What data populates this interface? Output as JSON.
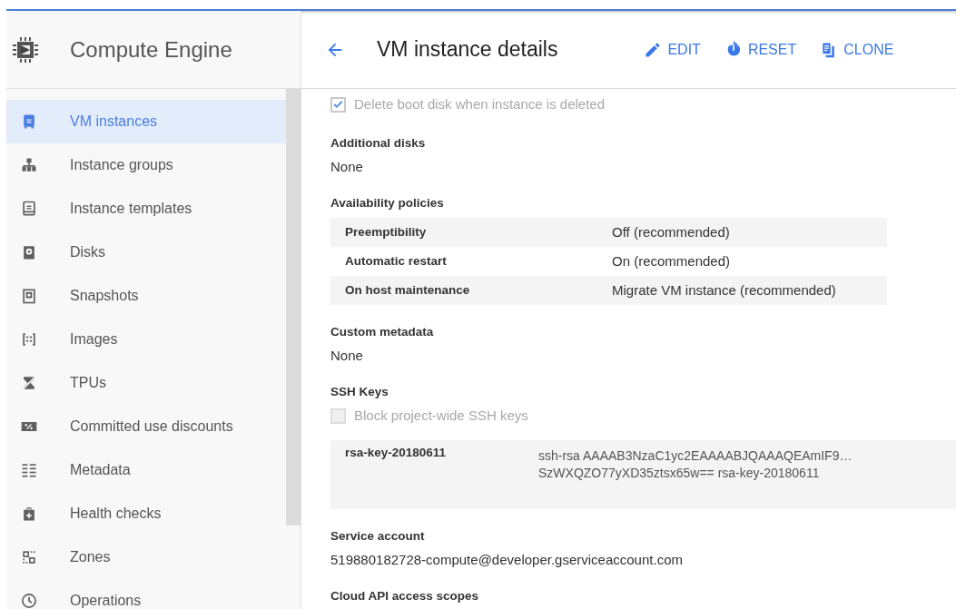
{
  "sidebar": {
    "product": "Compute Engine",
    "items": [
      {
        "label": "VM instances",
        "selected": true
      },
      {
        "label": "Instance groups",
        "selected": false
      },
      {
        "label": "Instance templates",
        "selected": false
      },
      {
        "label": "Disks",
        "selected": false
      },
      {
        "label": "Snapshots",
        "selected": false
      },
      {
        "label": "Images",
        "selected": false
      },
      {
        "label": "TPUs",
        "selected": false
      },
      {
        "label": "Committed use discounts",
        "selected": false
      },
      {
        "label": "Metadata",
        "selected": false
      },
      {
        "label": "Health checks",
        "selected": false
      },
      {
        "label": "Zones",
        "selected": false
      },
      {
        "label": "Operations",
        "selected": false
      }
    ]
  },
  "page": {
    "title": "VM instance details",
    "actions": [
      {
        "label": "EDIT"
      },
      {
        "label": "RESET"
      },
      {
        "label": "CLONE"
      }
    ]
  },
  "content": [
    {
      "kind": "checkbox",
      "label": "Delete boot disk when instance is deleted",
      "checked": true
    },
    {
      "kind": "heading",
      "text": "Additional disks"
    },
    {
      "kind": "value",
      "text": "None"
    },
    {
      "kind": "heading",
      "text": "Availability policies"
    },
    {
      "kind": "table",
      "rows": [
        {
          "label": "Preemptibility",
          "value": "Off (recommended)"
        },
        {
          "label": "Automatic restart",
          "value": "On (recommended)"
        },
        {
          "label": "On host maintenance",
          "value": "Migrate VM instance (recommended)"
        }
      ]
    },
    {
      "kind": "heading",
      "text": "Custom metadata"
    },
    {
      "kind": "value",
      "text": "None"
    },
    {
      "kind": "heading",
      "text": "SSH Keys"
    },
    {
      "kind": "checkbox",
      "label": "Block project-wide SSH keys",
      "checked": false
    },
    {
      "kind": "keys",
      "rows": [
        {
          "name": "rsa-key-20180611",
          "lines": [
            "ssh-rsa AAAAB3NzaC1yc2EAAAABJQAAAQEAmIF9…",
            "SzWXQZO77yXD35ztsx65w== rsa-key-20180611"
          ]
        }
      ]
    },
    {
      "kind": "heading",
      "text": "Service account"
    },
    {
      "kind": "value",
      "text": "519880182728-compute@developer.gserviceaccount.com"
    },
    {
      "kind": "heading",
      "text": "Cloud API access scopes"
    }
  ]
}
